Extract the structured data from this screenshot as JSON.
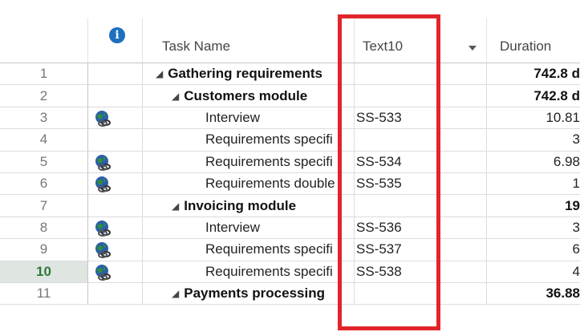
{
  "header": {
    "info_glyph": "i",
    "task_name": "Task Name",
    "text10": "Text10",
    "duration": "Duration"
  },
  "rows": [
    {
      "num": "1",
      "name": "Gathering requirements",
      "text10": "",
      "duration": "742.8 d",
      "summary": true,
      "level": 0,
      "icon": false,
      "selected": false
    },
    {
      "num": "2",
      "name": "Customers module",
      "text10": "",
      "duration": "742.8 d",
      "summary": true,
      "level": 1,
      "icon": false,
      "selected": false
    },
    {
      "num": "3",
      "name": "Interview",
      "text10": "SS-533",
      "duration": "10.81",
      "summary": false,
      "level": 2,
      "icon": true,
      "selected": false
    },
    {
      "num": "4",
      "name": "Requirements specifi",
      "text10": "",
      "duration": "3",
      "summary": false,
      "level": 2,
      "icon": false,
      "selected": false
    },
    {
      "num": "5",
      "name": "Requirements specifi",
      "text10": "SS-534",
      "duration": "6.98",
      "summary": false,
      "level": 2,
      "icon": true,
      "selected": false
    },
    {
      "num": "6",
      "name": "Requirements double",
      "text10": "SS-535",
      "duration": "1",
      "summary": false,
      "level": 2,
      "icon": true,
      "selected": false
    },
    {
      "num": "7",
      "name": "Invoicing module",
      "text10": "",
      "duration": "19",
      "summary": true,
      "level": 1,
      "icon": false,
      "selected": false
    },
    {
      "num": "8",
      "name": "Interview",
      "text10": "SS-536",
      "duration": "3",
      "summary": false,
      "level": 2,
      "icon": true,
      "selected": false
    },
    {
      "num": "9",
      "name": "Requirements specifi",
      "text10": "SS-537",
      "duration": "6",
      "summary": false,
      "level": 2,
      "icon": true,
      "selected": false
    },
    {
      "num": "10",
      "name": "Requirements specifi",
      "text10": "SS-538",
      "duration": "4",
      "summary": false,
      "level": 2,
      "icon": true,
      "selected": true
    },
    {
      "num": "11",
      "name": "Payments processing",
      "text10": "",
      "duration": "36.88",
      "summary": true,
      "level": 1,
      "icon": false,
      "selected": false
    }
  ],
  "colors": {
    "highlight": "#e2242b",
    "info_icon": "#1d6fc0",
    "selected_row_number": "#2a7a3a"
  },
  "icons": {
    "info": "info-icon",
    "indicator": "globe-link-icon",
    "outline": "collapse-triangle-icon",
    "column_menu": "chevron-down-icon"
  }
}
